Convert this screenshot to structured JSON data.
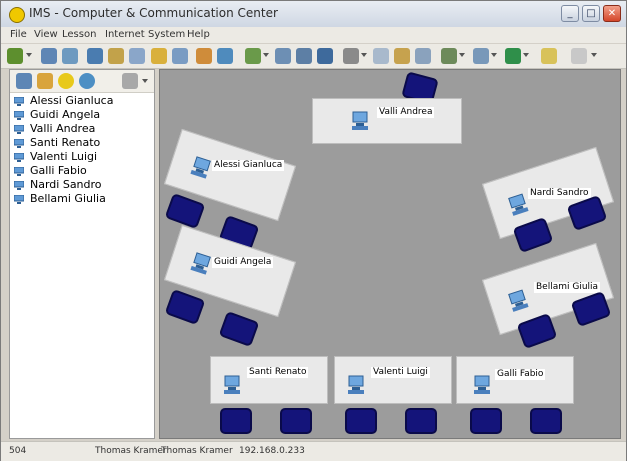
{
  "window": {
    "title": "IMS - Computer & Communication Center",
    "controls": {
      "minimize": "_",
      "maximize": "□",
      "close": "✕"
    }
  },
  "menu": [
    "File",
    "View",
    "Lesson",
    "Internet",
    "System",
    "Help"
  ],
  "toolbar_icons": [
    "users-icon",
    "monitor-icon",
    "screen-icon",
    "broadcast-icon",
    "note-icon",
    "lock-icon",
    "chat-icon",
    "transfer-icon",
    "folder-icon",
    "display-icon",
    "network-icon",
    "keyboard-icon",
    "paste-icon",
    "help-icon",
    "gear-icon",
    "tools-icon",
    "user-icon",
    "settings-icon",
    "globe-icon",
    "window-icon",
    "search-icon"
  ],
  "panel_tabs": [
    "computer-icon",
    "folder-icon",
    "clock-icon",
    "globe-icon",
    "grid-icon"
  ],
  "students": [
    "Alessi Gianluca",
    "Guidi Angela",
    "Valli Andrea",
    "Santi Renato",
    "Valenti Luigi",
    "Galli Fabio",
    "Nardi Sandro",
    "Bellami Giulia"
  ],
  "classroom": {
    "desk_labels": [
      "Valli Andrea",
      "Alessi Gianluca",
      "Guidi Angela",
      "Nardi Sandro",
      "Bellami Giulia",
      "Santi Renato",
      "Valenti Luigi",
      "Galli Fabio"
    ]
  },
  "status": {
    "code": "504",
    "user1": "Thomas Kramer",
    "user2": "Thomas Kramer",
    "ip": "192.168.0.233"
  },
  "colors": {
    "chair": "#14147a",
    "floor": "#9c9c9c",
    "desk": "#e9e9e9"
  }
}
